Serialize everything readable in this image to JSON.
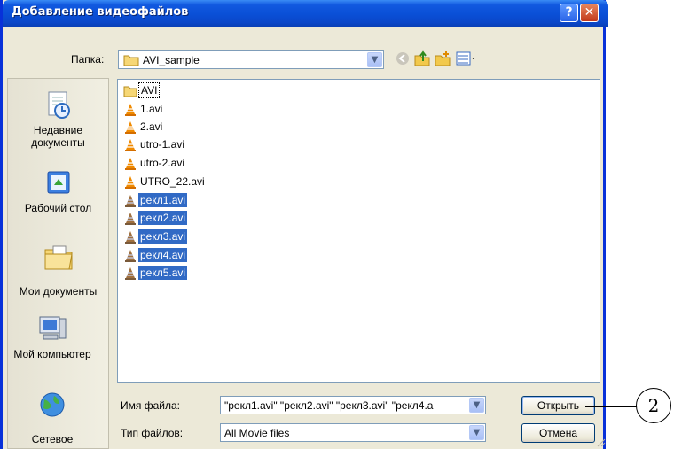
{
  "dialog": {
    "title": "Добавление видеофайлов",
    "help_label": "?",
    "close_label": "✕"
  },
  "folder": {
    "label": "Папка:",
    "value": "AVI_sample"
  },
  "places": [
    {
      "label": "Недавние документы",
      "icon": "recent-documents-icon"
    },
    {
      "label": "Рабочий стол",
      "icon": "desktop-icon"
    },
    {
      "label": "Мои документы",
      "icon": "my-documents-icon"
    },
    {
      "label": "Мой компьютер",
      "icon": "my-computer-icon"
    },
    {
      "label": "Сетевое",
      "icon": "network-icon"
    }
  ],
  "files": [
    {
      "name": "AVI",
      "type": "folder",
      "selected": false
    },
    {
      "name": "1.avi",
      "type": "avi",
      "selected": false
    },
    {
      "name": "2.avi",
      "type": "avi",
      "selected": false
    },
    {
      "name": "utro-1.avi",
      "type": "avi",
      "selected": false
    },
    {
      "name": "utro-2.avi",
      "type": "avi",
      "selected": false
    },
    {
      "name": "UTRO_22.avi",
      "type": "avi",
      "selected": false
    },
    {
      "name": "рекл1.avi",
      "type": "avi",
      "selected": true
    },
    {
      "name": "рекл2.avi",
      "type": "avi",
      "selected": true
    },
    {
      "name": "рекл3.avi",
      "type": "avi",
      "selected": true
    },
    {
      "name": "рекл4.avi",
      "type": "avi",
      "selected": true
    },
    {
      "name": "рекл5.avi",
      "type": "avi",
      "selected": true
    }
  ],
  "filename": {
    "label": "Имя файла:",
    "value": "\"рекл1.avi\" \"рекл2.avi\" \"рекл3.avi\" \"рекл4.a"
  },
  "filetype": {
    "label": "Тип файлов:",
    "value": "All Movie files"
  },
  "buttons": {
    "open": "Открыть",
    "cancel": "Отмена"
  },
  "callout": "2",
  "colors": {
    "title_bar": "#0a4fd6",
    "selection": "#316ac5",
    "dialog_bg": "#ece9d8"
  }
}
